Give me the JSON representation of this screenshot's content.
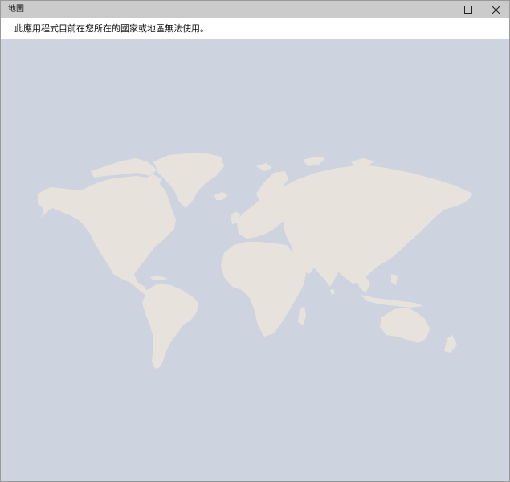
{
  "window": {
    "title": "地圖"
  },
  "notice": {
    "message": "此應用程式目前在您所在的國家或地區無法使用。"
  },
  "map": {
    "ocean_color": "#cdd4df",
    "land_color": "#e7e3dc"
  },
  "icons": {
    "minimize": "minimize-icon",
    "maximize": "maximize-icon",
    "close": "close-icon"
  }
}
